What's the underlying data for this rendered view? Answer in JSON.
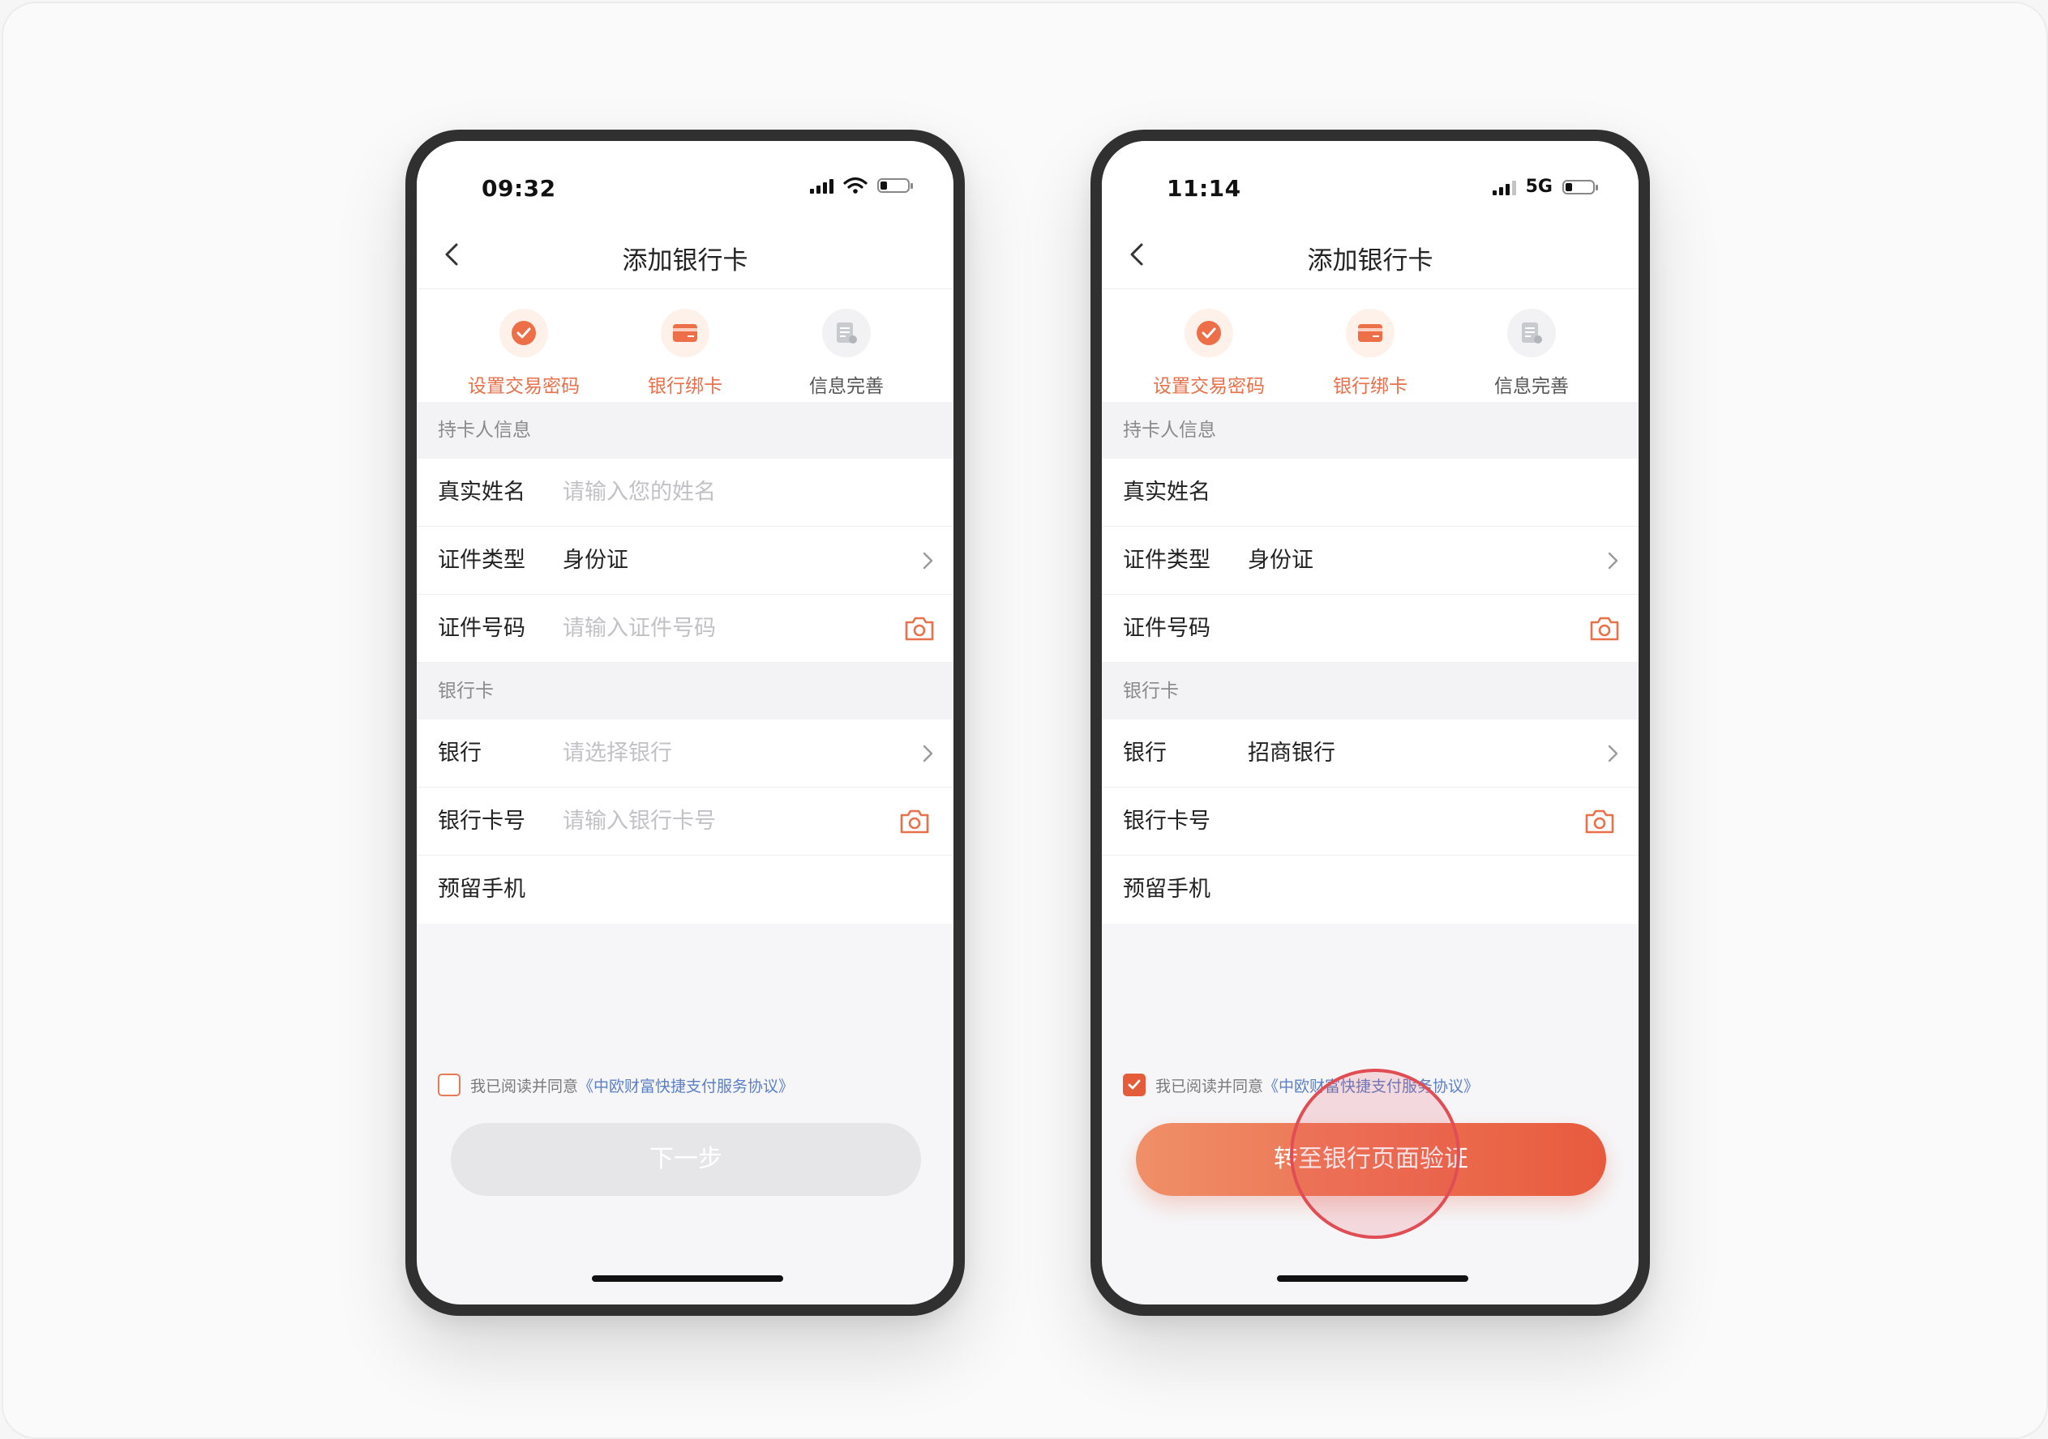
{
  "colors": {
    "accent": "#e8704a",
    "link": "#5b7fc4",
    "disabled_button": "#e6e6e8",
    "tap_indicator": "#e14d55"
  },
  "phones": [
    {
      "status_bar": {
        "time": "09:32",
        "network": ""
      },
      "nav": {
        "title": "添加银行卡"
      },
      "steps": [
        {
          "label": "设置交易密码",
          "state": "done",
          "icon": "check-circle-icon"
        },
        {
          "label": "银行绑卡",
          "state": "active",
          "icon": "bank-card-icon"
        },
        {
          "label": "信息完善",
          "state": "todo",
          "icon": "document-icon"
        }
      ],
      "sections": {
        "holder": "持卡人信息",
        "bank": "银行卡"
      },
      "fields": {
        "name": {
          "label": "真实姓名",
          "value": "",
          "placeholder": "请输入您的姓名"
        },
        "id_type": {
          "label": "证件类型",
          "value": "身份证"
        },
        "id_number": {
          "label": "证件号码",
          "value": "",
          "placeholder": "请输入证件号码"
        },
        "bank": {
          "label": "银行",
          "value": "",
          "placeholder": "请选择银行"
        },
        "card_number": {
          "label": "银行卡号",
          "value": "",
          "placeholder": "请输入银行卡号"
        },
        "phone": {
          "label": "预留手机",
          "value": ""
        }
      },
      "agreement": {
        "checked": false,
        "text": "我已阅读并同意",
        "link": "《中欧财富快捷支付服务协议》"
      },
      "button": {
        "label": "下一步",
        "enabled": false
      }
    },
    {
      "status_bar": {
        "time": "11:14",
        "network": "5G"
      },
      "nav": {
        "title": "添加银行卡"
      },
      "steps": [
        {
          "label": "设置交易密码",
          "state": "done",
          "icon": "check-circle-icon"
        },
        {
          "label": "银行绑卡",
          "state": "active",
          "icon": "bank-card-icon"
        },
        {
          "label": "信息完善",
          "state": "todo",
          "icon": "document-icon"
        }
      ],
      "sections": {
        "holder": "持卡人信息",
        "bank": "银行卡"
      },
      "fields": {
        "name": {
          "label": "真实姓名",
          "value": ""
        },
        "id_type": {
          "label": "证件类型",
          "value": "身份证"
        },
        "id_number": {
          "label": "证件号码",
          "value": ""
        },
        "bank": {
          "label": "银行",
          "value": "招商银行"
        },
        "card_number": {
          "label": "银行卡号",
          "value": ""
        },
        "phone": {
          "label": "预留手机",
          "value": ""
        }
      },
      "agreement": {
        "checked": true,
        "text": "我已阅读并同意",
        "link": "《中欧财富快捷支付服务协议》"
      },
      "button": {
        "label": "转至银行页面验证",
        "enabled": true
      }
    }
  ]
}
